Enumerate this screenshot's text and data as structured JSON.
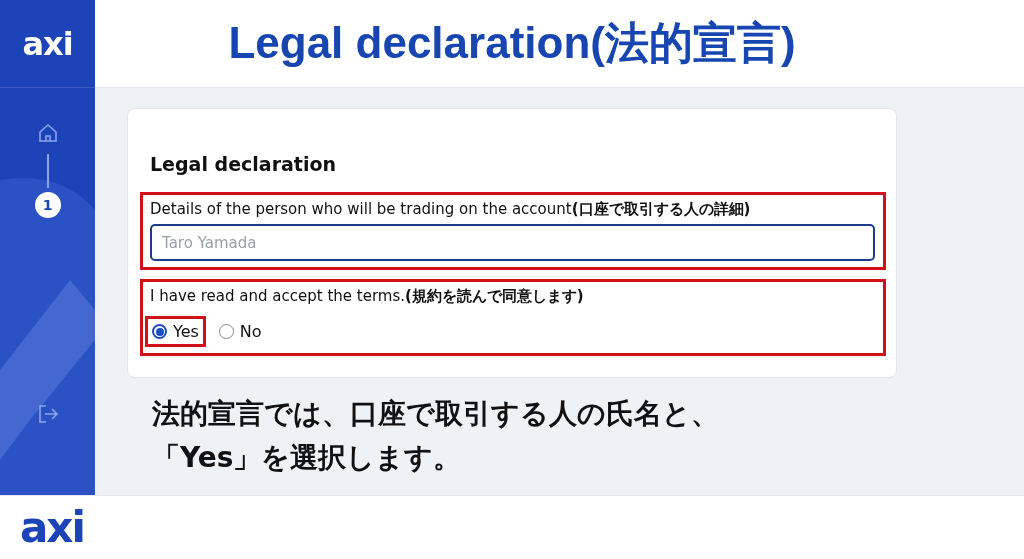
{
  "sidebar": {
    "logo": "axi",
    "steps": [
      {
        "label": "1",
        "selected": true
      }
    ]
  },
  "title": "Legal declaration(法的宣言)",
  "form": {
    "heading": "Legal declaration",
    "fields": [
      {
        "kind": "text",
        "label": "Details of the person who will be trading on the account**(口座で取引する人の詳細)**",
        "placeholder": "Taro Yamada",
        "highlighted": true
      },
      {
        "kind": "radio",
        "label": "I have read and accept the terms.**(規約を読んで同意します)**",
        "highlighted": true,
        "options": [
          {
            "label": "Yes",
            "selected": true,
            "highlighted": true
          },
          {
            "label": "No",
            "selected": false,
            "highlighted": false
          }
        ]
      }
    ]
  },
  "caption": [
    "法的宣言では、口座で取引する人の氏名と、",
    "「Yes」を選択します。"
  ],
  "footer": {
    "logo": "axi"
  }
}
